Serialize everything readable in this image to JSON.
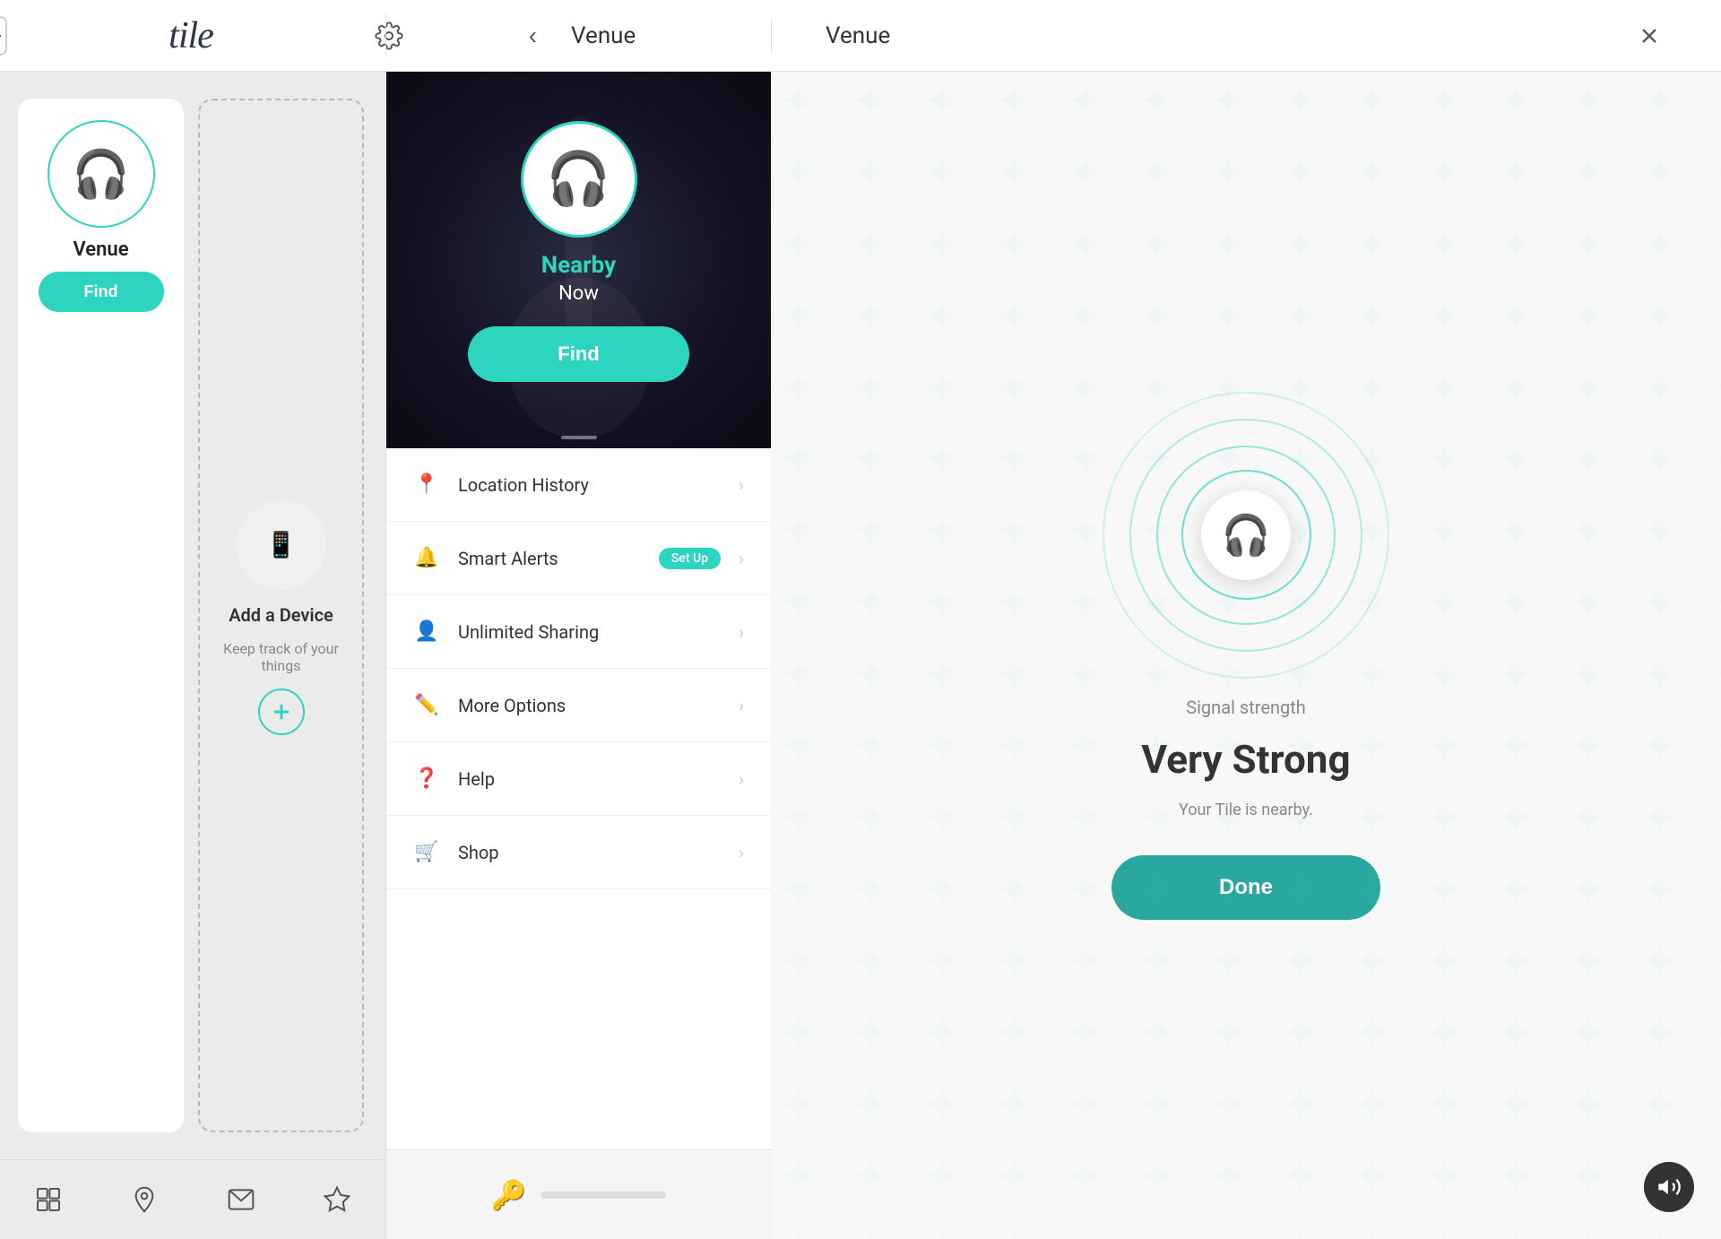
{
  "app": {
    "name": "tile",
    "title": "tile"
  },
  "header": {
    "add_button_label": "+",
    "left_title": "Venue",
    "center_title": "Venue",
    "right_title": "Venue",
    "back_label": "‹",
    "close_label": "✕"
  },
  "left_panel": {
    "device_name": "Venue",
    "find_button": "Find",
    "add_device_title": "Add a Device",
    "add_device_subtitle": "Keep track of your things"
  },
  "bottom_nav": {
    "items": [
      {
        "label": "Tiles",
        "icon": "tile-icon"
      },
      {
        "label": "Map",
        "icon": "map-icon"
      },
      {
        "label": "Notifications",
        "icon": "mail-icon"
      },
      {
        "label": "Premium",
        "icon": "star-icon"
      }
    ]
  },
  "middle_panel": {
    "nearby_label": "Nearby",
    "now_label": "Now",
    "find_button": "Find",
    "menu_items": [
      {
        "icon": "📍",
        "label": "Location History",
        "badge": null
      },
      {
        "icon": "🔔",
        "label": "Smart Alerts",
        "badge": "Set Up"
      },
      {
        "icon": "👤",
        "label": "Unlimited Sharing",
        "badge": null
      },
      {
        "icon": "✏️",
        "label": "More Options",
        "badge": null
      },
      {
        "icon": "❓",
        "label": "Help",
        "badge": null
      },
      {
        "icon": "🛒",
        "label": "Shop",
        "badge": null
      }
    ]
  },
  "right_panel": {
    "signal_label": "Signal strength",
    "signal_strength": "Very Strong",
    "nearby_text": "Your Tile is nearby.",
    "done_button": "Done"
  },
  "colors": {
    "teal": "#2dd4bf",
    "teal_dark": "#2aa8a0",
    "text_dark": "#333",
    "text_light": "#888"
  }
}
